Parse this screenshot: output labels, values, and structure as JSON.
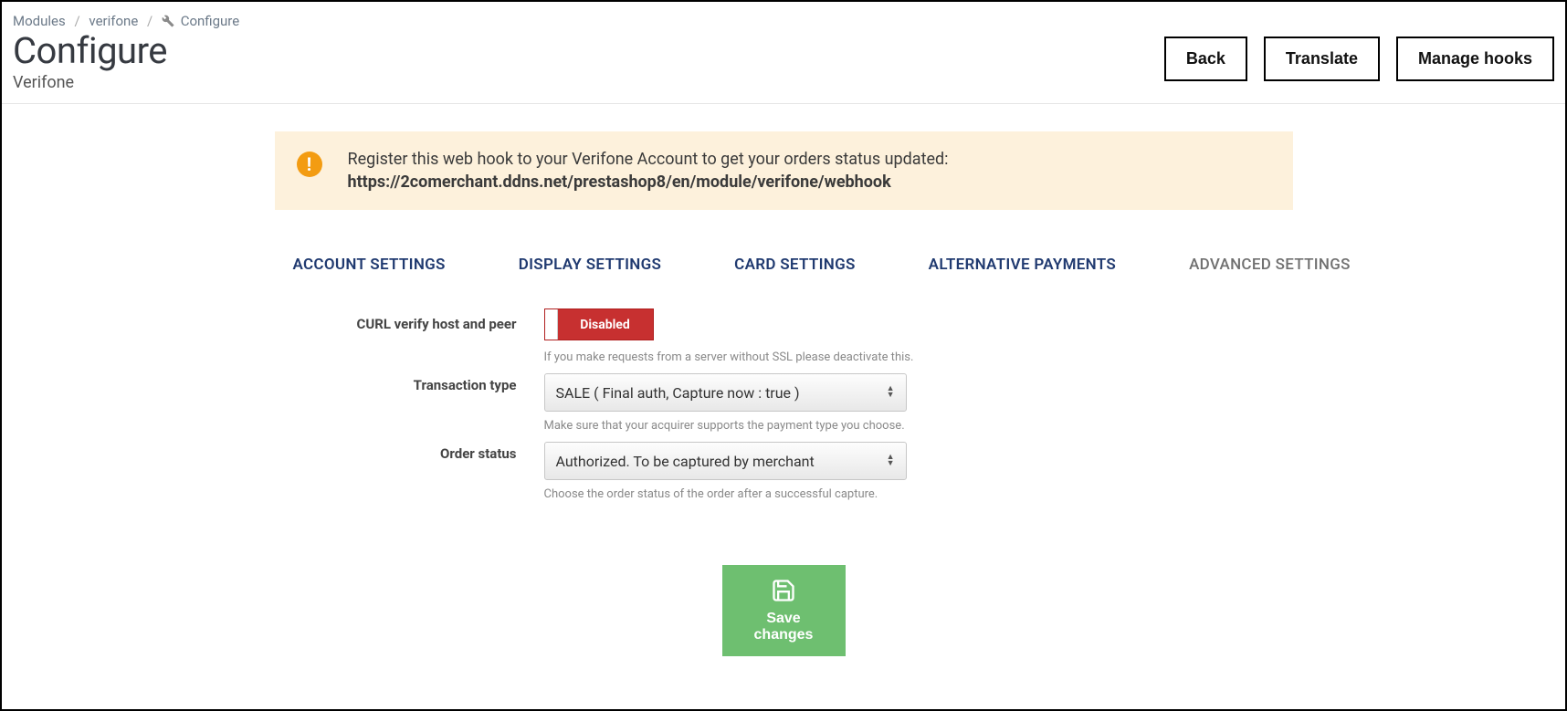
{
  "breadcrumb": {
    "modules": "Modules",
    "module": "verifone",
    "page": "Configure"
  },
  "header": {
    "title": "Configure",
    "subtitle": "Verifone",
    "buttons": {
      "back": "Back",
      "translate": "Translate",
      "manage_hooks": "Manage hooks"
    }
  },
  "alert": {
    "message": "Register this web hook to your Verifone Account to get your orders status updated:",
    "url": "https://2comerchant.ddns.net/prestashop8/en/module/verifone/webhook"
  },
  "tabs": {
    "account": "ACCOUNT SETTINGS",
    "display": "DISPLAY SETTINGS",
    "card": "CARD SETTINGS",
    "alternative": "ALTERNATIVE PAYMENTS",
    "advanced": "ADVANCED SETTINGS"
  },
  "form": {
    "curl": {
      "label": "CURL verify host and peer",
      "toggle_value": "Disabled",
      "help": "If you make requests from a server without SSL please deactivate this."
    },
    "transaction": {
      "label": "Transaction type",
      "value": "SALE ( Final auth, Capture now : true )",
      "help": "Make sure that your acquirer supports the payment type you choose."
    },
    "order_status": {
      "label": "Order status",
      "value": "Authorized. To be captured by merchant",
      "help": "Choose the order status of the order after a successful capture."
    }
  },
  "save_label": "Save changes"
}
